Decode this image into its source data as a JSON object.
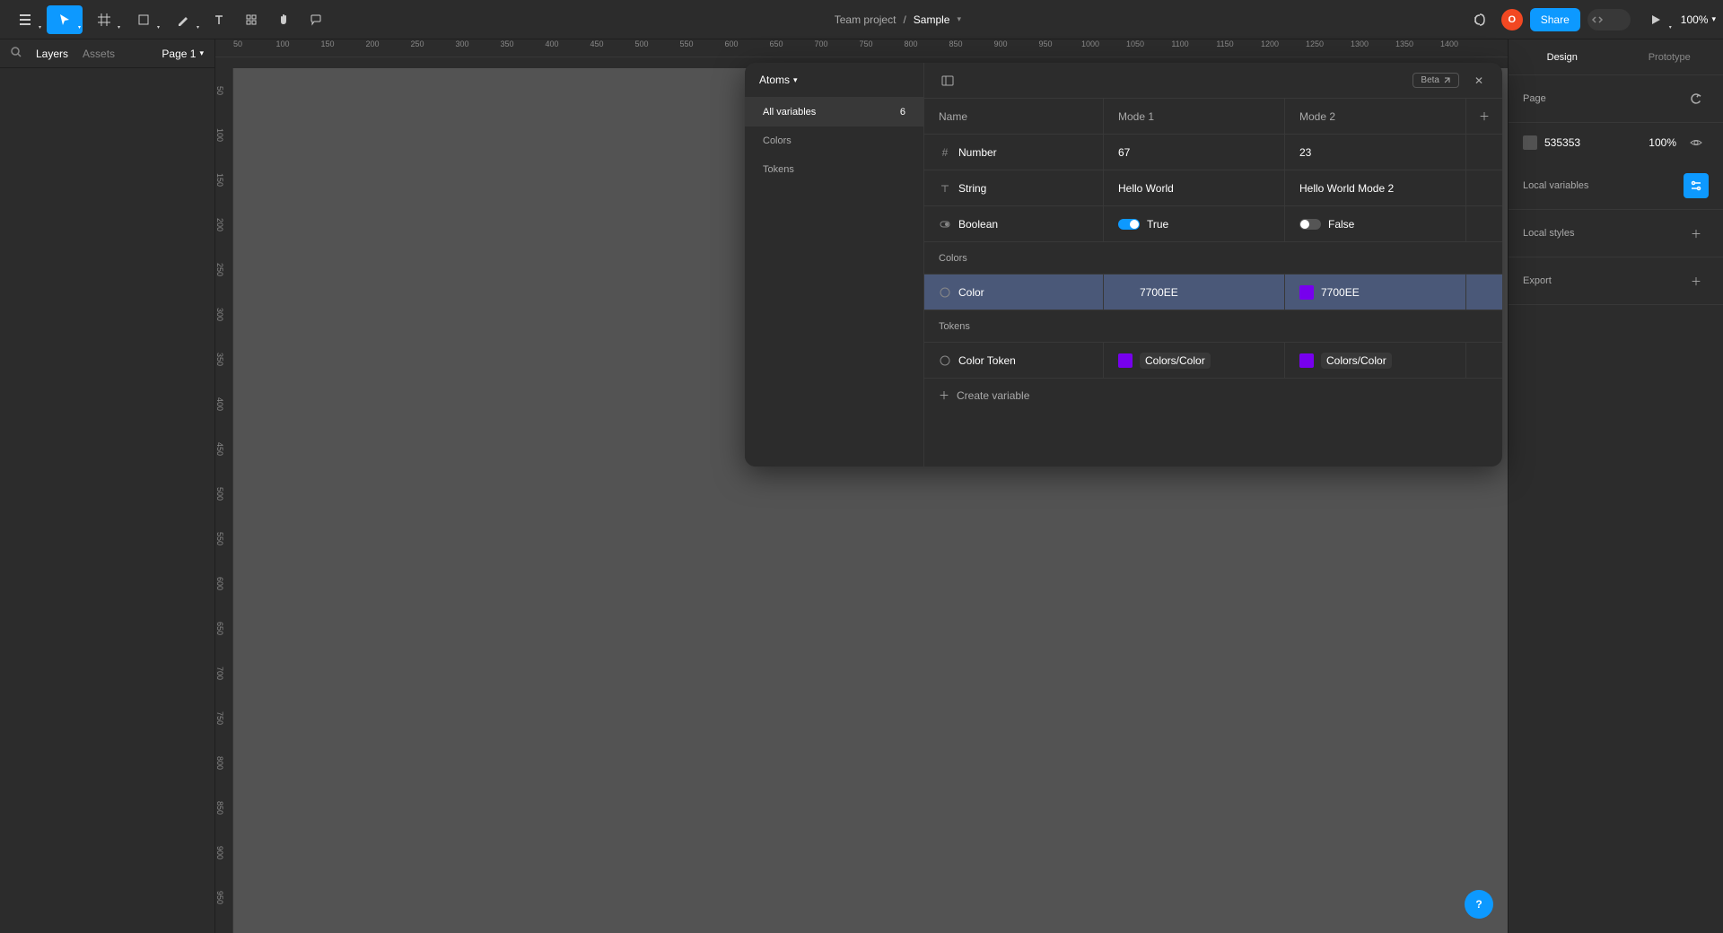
{
  "toolbar": {
    "team": "Team project",
    "file": "Sample",
    "share": "Share",
    "avatar_initial": "O",
    "zoom": "100%"
  },
  "secbar": {
    "layers": "Layers",
    "assets": "Assets",
    "page": "Page 1"
  },
  "ruler_h": [
    "50",
    "100",
    "150",
    "200",
    "250",
    "300",
    "350",
    "400",
    "450",
    "500",
    "550",
    "600",
    "650",
    "700",
    "750",
    "800",
    "850",
    "900",
    "950",
    "1000",
    "1050",
    "1100",
    "1150",
    "1200",
    "1250",
    "1300",
    "1350",
    "1400"
  ],
  "ruler_v": [
    "50",
    "100",
    "150",
    "200",
    "250",
    "300",
    "350",
    "400",
    "450",
    "500",
    "550",
    "600",
    "650",
    "700",
    "750",
    "800",
    "850",
    "900",
    "950"
  ],
  "right": {
    "tabs": {
      "design": "Design",
      "prototype": "Prototype"
    },
    "page_label": "Page",
    "page_bg": "535353",
    "page_opacity": "100%",
    "local_variables": "Local variables",
    "local_styles": "Local styles",
    "export": "Export"
  },
  "modal": {
    "collection": "Atoms",
    "sidebar": {
      "all": "All variables",
      "all_count": "6",
      "colors": "Colors",
      "tokens": "Tokens"
    },
    "beta": "Beta",
    "cols": {
      "name": "Name",
      "mode1": "Mode 1",
      "mode2": "Mode 2"
    },
    "groups": {
      "colors": "Colors",
      "tokens": "Tokens"
    },
    "vars": {
      "number": {
        "name": "Number",
        "m1": "67",
        "m2": "23"
      },
      "string": {
        "name": "String",
        "m1": "Hello World",
        "m2": "Hello World Mode 2"
      },
      "boolean": {
        "name": "Boolean",
        "m1": "True",
        "m2": "False"
      },
      "color": {
        "name": "Color",
        "m1": "7700EE",
        "m2": "7700EE",
        "hex": "#7700EE"
      },
      "colortoken": {
        "name": "Color Token",
        "m1": "Colors/Color",
        "m2": "Colors/Color",
        "hex": "#7700EE"
      }
    },
    "create": "Create variable"
  }
}
